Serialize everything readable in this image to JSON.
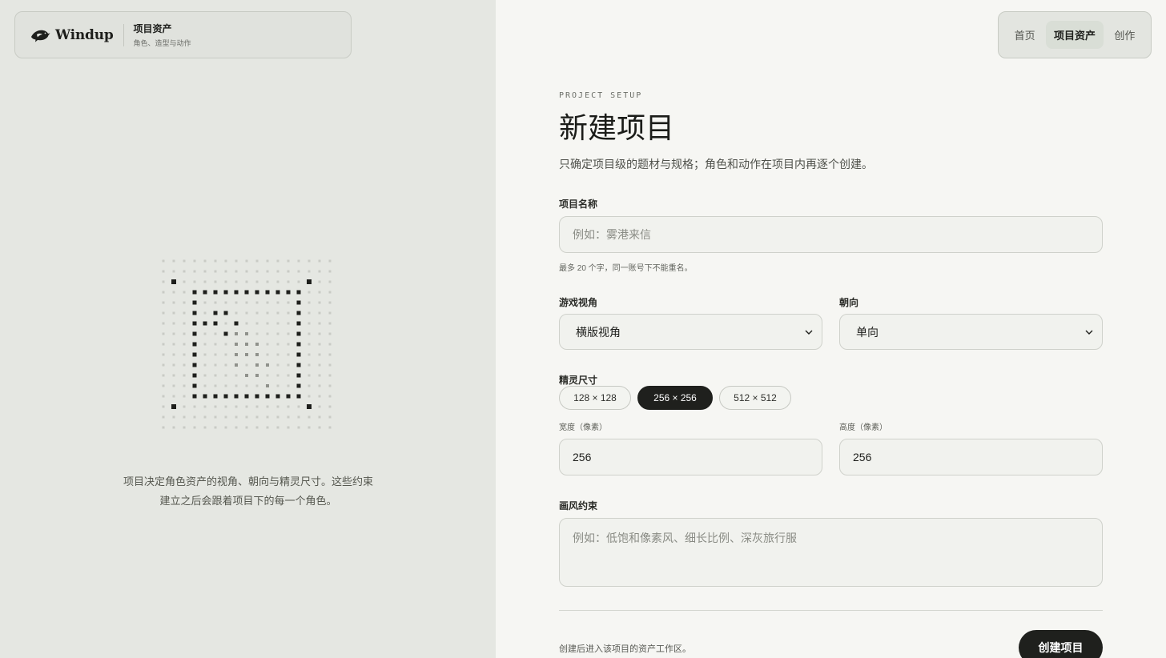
{
  "brand": {
    "name": "Windup",
    "section": "项目资产",
    "subtitle": "角色、造型与动作",
    "logo_icon": "bird-logo-icon"
  },
  "nav": {
    "items": [
      {
        "label": "首页",
        "active": false
      },
      {
        "label": "项目资产",
        "active": true
      },
      {
        "label": "创作",
        "active": false
      }
    ]
  },
  "left": {
    "caption_line1": "项目决定角色资产的视角、朝向与精灵尺寸。这些约束",
    "caption_line2": "建立之后会跟着项目下的每一个角色。",
    "illustration_icon": "pixel-grid-sprite-icon"
  },
  "form": {
    "eyebrow": "PROJECT SETUP",
    "title": "新建项目",
    "description": "只确定项目级的题材与规格；角色和动作在项目内再逐个创建。",
    "project_name": {
      "label": "项目名称",
      "placeholder": "例如：雾港来信",
      "value": "",
      "hint": "最多 20 个字，同一账号下不能重名。"
    },
    "perspective": {
      "label": "游戏视角",
      "value": "横版视角"
    },
    "facing": {
      "label": "朝向",
      "value": "单向"
    },
    "sprite_size": {
      "label": "精灵尺寸",
      "options": [
        "128 × 128",
        "256 × 256",
        "512 × 512"
      ],
      "selected": "256 × 256",
      "width_label": "宽度（像素）",
      "width_value": "256",
      "height_label": "高度（像素）",
      "height_value": "256"
    },
    "style": {
      "label": "画风约束",
      "placeholder": "例如：低饱和像素风、细长比例、深灰旅行服",
      "value": ""
    },
    "footer_note": "创建后进入该项目的资产工作区。",
    "submit_label": "创建项目"
  },
  "colors": {
    "accent": "#1f201d",
    "left_bg": "#e5e7e2",
    "right_bg": "#f6f6f3",
    "nav_active_bg": "#d9ded6"
  }
}
